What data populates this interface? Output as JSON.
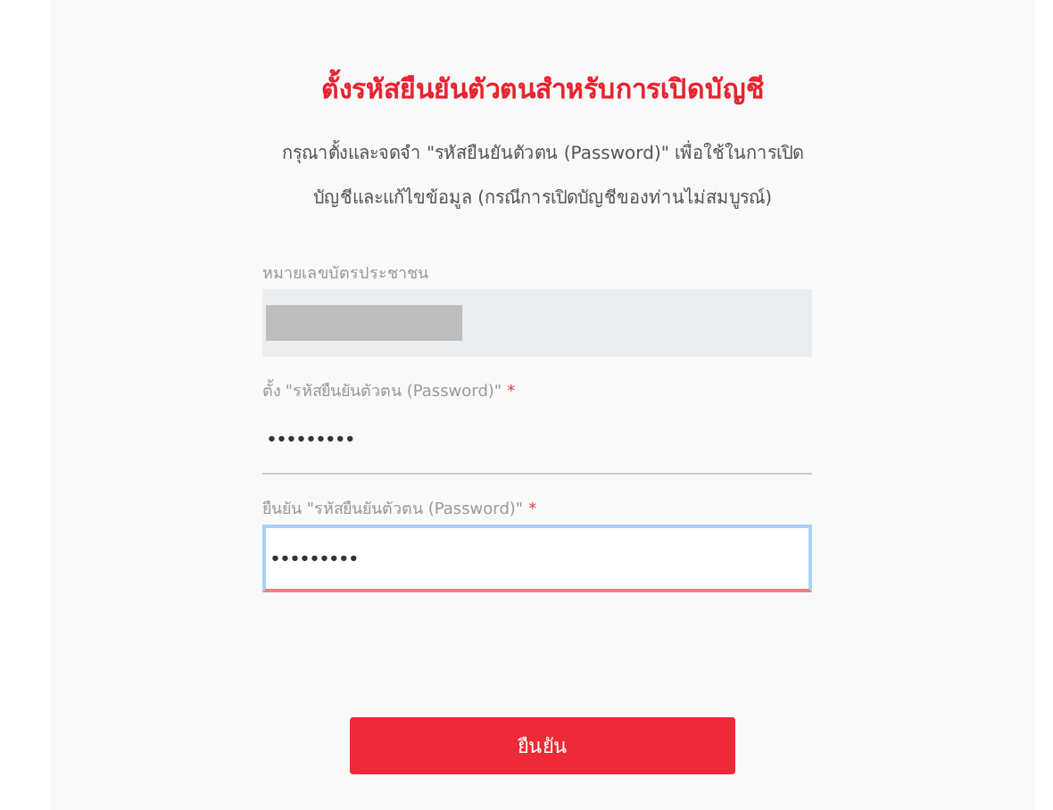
{
  "title": "ตั้งรหัสยืนยันตัวตนสำหรับการเปิดบัญชี",
  "description": "กรุณาตั้งและจดจำ \"รหัสยืนยันตัวตน (Password)\" เพื่อใช้ในการเปิดบัญชีและแก้ไขข้อมูล (กรณีการเปิดบัญชีของท่านไม่สมบูรณ์)",
  "fields": [
    {
      "label": "หมายเลขบัตรประชาชน",
      "disabled": true,
      "redacted": true,
      "focused": false
    },
    {
      "label": "ตั้ง \"รหัสยืนยันตัวตน (Password)\"",
      "required_mark": "*",
      "disabled": false,
      "focused": false,
      "value": "•••••••••"
    },
    {
      "label": "ยืนยัน \"รหัสยืนยันตัวตน (Password)\"",
      "required_mark": "*",
      "disabled": false,
      "focused": true,
      "value": "•••••••••"
    }
  ],
  "submit": {
    "label": "ยืนยัน"
  }
}
